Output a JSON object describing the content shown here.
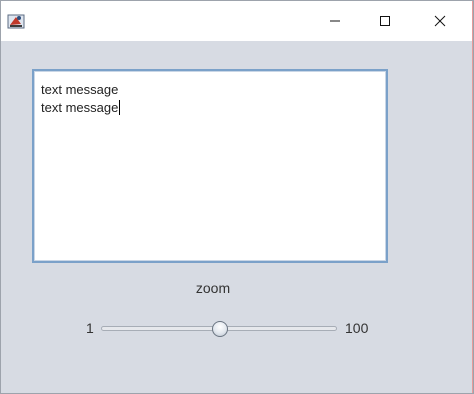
{
  "window": {
    "icons": {
      "app": "java-app-icon",
      "minimize": "minimize-icon",
      "maximize": "maximize-icon",
      "close": "close-icon"
    }
  },
  "textarea": {
    "lines": [
      "text message",
      "text message"
    ]
  },
  "zoom": {
    "label": "zoom",
    "min_label": "1",
    "max_label": "100",
    "min": 1,
    "max": 100,
    "value": 51
  },
  "colors": {
    "background": "#d7dbe3",
    "textarea_border": "#7ba1c9",
    "titlebar": "#ffffff"
  }
}
